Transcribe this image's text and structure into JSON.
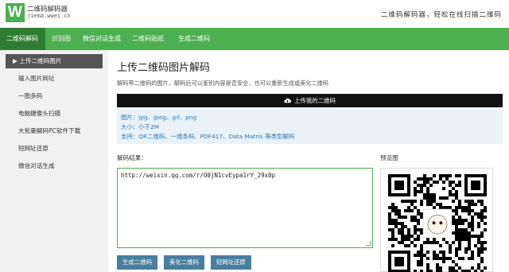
{
  "header": {
    "logo_letter": "W",
    "brand_name": "二维码解码器",
    "brand_url": "jiema.wwei.cn",
    "tagline": "二维码解码器，轻松在线扫描二维码"
  },
  "nav": {
    "items": [
      "二维码解码",
      "识别图",
      "微信对话生成",
      "二维码贴纸",
      "生成二维码"
    ]
  },
  "sidebar": {
    "items": [
      "上传二维码图片",
      "输入图片网址",
      "一图多码",
      "电脑摄像头扫描",
      "大批量解码PC软件下载",
      "短网址还原",
      "微信对话生成"
    ]
  },
  "main": {
    "title": "上传二维码图片解码",
    "description": "解码带二维码的图片，解码后可以鉴别内容是否安全，也可以重新生成或美化二维码",
    "upload_label": "上传我的二维码",
    "info": {
      "formats": "图片：jpg、jpeg、gif、png",
      "size": "大小：小于2M",
      "support": "支持：QR二维码、一维条码、PDF417、Data Matrix 等类型解码"
    },
    "result_label": "解码结果：",
    "result_value": "http://weixin.qq.com/r/O0jN1cvEypa1rY_29x0p",
    "buttons": [
      "生成二维码",
      "美化二维码",
      "短网址还原"
    ],
    "preview_label": "预览图"
  },
  "colors": {
    "brand_green": "#4caf50",
    "nav_active": "#2e7d32",
    "button_blue": "#4a7e9e",
    "info_bg": "#e9f2f9",
    "info_text": "#2a7ab8"
  },
  "icons": {
    "upload": "cloud-upload-icon",
    "sidebar_active": "play-arrow-icon"
  }
}
